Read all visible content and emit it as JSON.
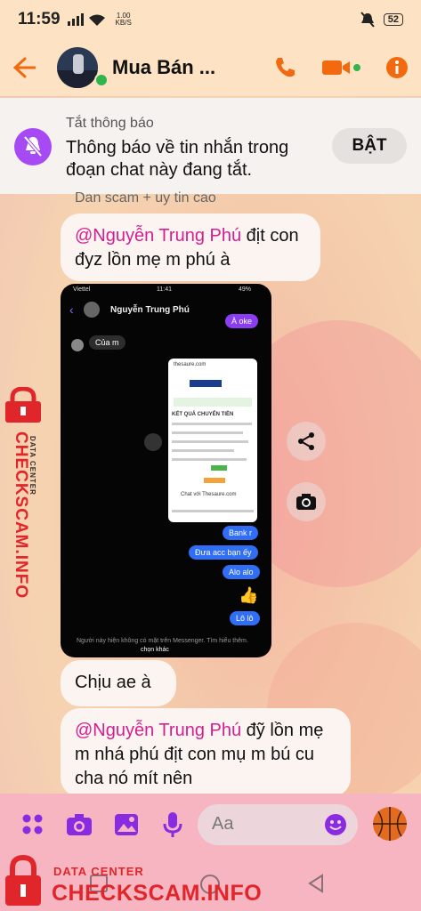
{
  "status_bar": {
    "time": "11:59",
    "net_speed_value": "1.00",
    "net_speed_unit": "KB/S",
    "battery": "52"
  },
  "header": {
    "contact_name": "Mua Bán ..."
  },
  "notice": {
    "label": "Tắt thông báo",
    "text": "Thông báo về tin nhắn trong đoạn chat này đang tắt.",
    "button": "BẬT"
  },
  "faded_message": "Dan scam + uy tin cao",
  "messages": [
    {
      "mention": "@Nguyễn Trung Phú",
      "text": " địt con đyz lồn mẹ m phú à"
    },
    {
      "text": "Chịu ae à"
    },
    {
      "mention": "@Nguyễn Trung Phú",
      "text": " đỹ lồn mẹ m nhá phú địt con mụ m bú cu cha nó mít nên"
    }
  ],
  "attachment": {
    "carrier": "Viettel",
    "time": "11:41",
    "battery": "49%",
    "contact": "Nguyễn Trung Phú",
    "bubble_aoke": "À oke",
    "bubble_cua_m": "Của m",
    "bubble_bank": "Bank r",
    "bubble_dua_acc": "Đưa acc bạn ếy",
    "bubble_alo": "Alo alo",
    "bubble_lolo": "Lô lô",
    "doc_title": "KẾT QUẢ CHUYỂN TIỀN",
    "doc_site": "thesaure.com",
    "doc_chat": "Chat với Thesaure.com",
    "footer": "Người này hiện không có mặt trên Messenger. Tìm hiểu thêm.",
    "footer2": "chọn khác"
  },
  "composer": {
    "placeholder": "Aa"
  },
  "watermark": {
    "small": "DATA CENTER",
    "big": "CHECKSCAM.INFO"
  },
  "colors": {
    "accent": "#f2690f",
    "messenger_purple": "#8a2be2",
    "mention": "#d61f8f",
    "watermark": "#e0262a"
  }
}
